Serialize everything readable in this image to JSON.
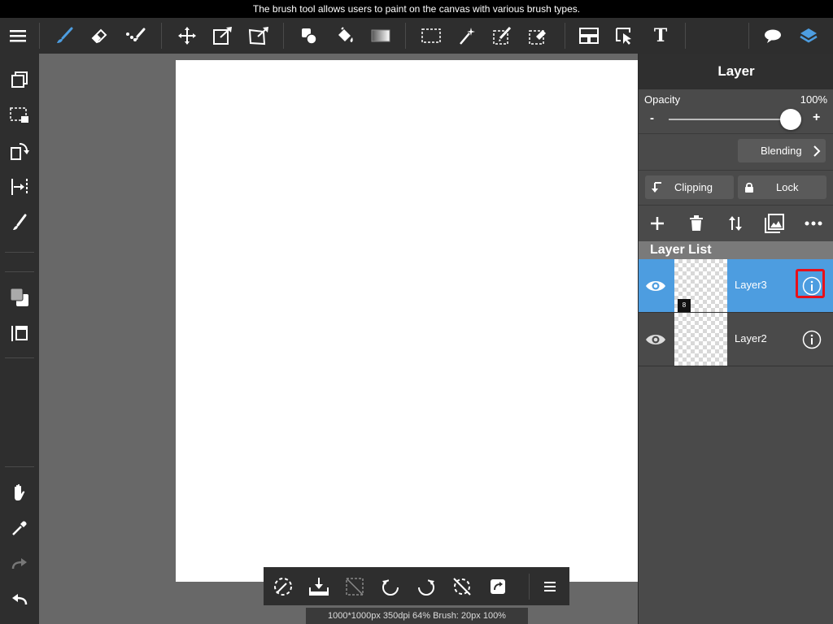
{
  "tooltip": "The brush tool allows users to paint on the canvas with various brush types.",
  "status_text": "1000*1000px 350dpi 64% Brush: 20px 100%",
  "colors": {
    "accent": "#4d9de0",
    "highlight": "#e8101a",
    "toolbar_bg": "#2e2e2e",
    "panel_bg": "#4a4a4a"
  },
  "toolbar": {
    "icons": [
      "menu-icon",
      "brush-icon",
      "eraser-icon",
      "smudge-icon",
      "move-icon",
      "transform-icon",
      "warp-icon",
      "shape-fill-icon",
      "bucket-icon",
      "gradient-icon",
      "select-rect-icon",
      "magic-wand-icon",
      "select-pen-icon",
      "select-eraser-icon",
      "layout-icon",
      "select-layer-icon",
      "text-icon",
      "speech-bubble-icon",
      "layers-icon"
    ],
    "text_tool_glyph": "T"
  },
  "panel": {
    "title": "Layer",
    "opacity_label": "Opacity",
    "opacity_value": "100%",
    "opacity": 1.0,
    "minus": "-",
    "plus": "+",
    "blending_label": "Blending",
    "clipping_label": "Clipping",
    "lock_label": "Lock",
    "list_header": "Layer List",
    "layers": [
      {
        "name": "Layer3",
        "badge": "8",
        "selected": true,
        "visible": true
      },
      {
        "name": "Layer2",
        "badge": "",
        "selected": false,
        "visible": true
      }
    ]
  }
}
